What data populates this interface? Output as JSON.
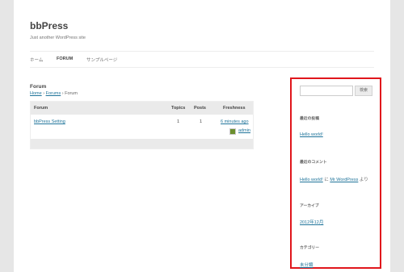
{
  "site": {
    "title": "bbPress",
    "description": "Just another WordPress site"
  },
  "nav": {
    "items": [
      {
        "label": "ホーム"
      },
      {
        "label": "FORUM"
      },
      {
        "label": "サンプルページ"
      }
    ]
  },
  "main": {
    "heading": "Forum",
    "breadcrumb": {
      "home": "Home",
      "sep1": "›",
      "forums": "Forums",
      "sep2": "›",
      "current": "Forum"
    },
    "table": {
      "headers": {
        "forum": "Forum",
        "topics": "Topics",
        "posts": "Posts",
        "freshness": "Freshness"
      },
      "rows": [
        {
          "forum": "bbPress Setting",
          "topics": "1",
          "posts": "1",
          "freshness": "6 minutes ago",
          "author": "admin"
        }
      ]
    }
  },
  "sidebar": {
    "search_button": "検索",
    "widgets": {
      "recent_posts": {
        "title": "最近の投稿",
        "items": [
          "Hello world!"
        ]
      },
      "recent_comments": {
        "title": "最近のコメント",
        "post_link": "Hello world!",
        "connector": "に",
        "author_link": "Mr WordPress",
        "suffix": "より"
      },
      "archives": {
        "title": "アーカイブ",
        "items": [
          "2012年12月"
        ]
      },
      "categories": {
        "title": "カテゴリー",
        "items": [
          "未分類"
        ]
      }
    }
  },
  "colors": {
    "highlight_border": "#e0161c",
    "link": "#21759b"
  }
}
